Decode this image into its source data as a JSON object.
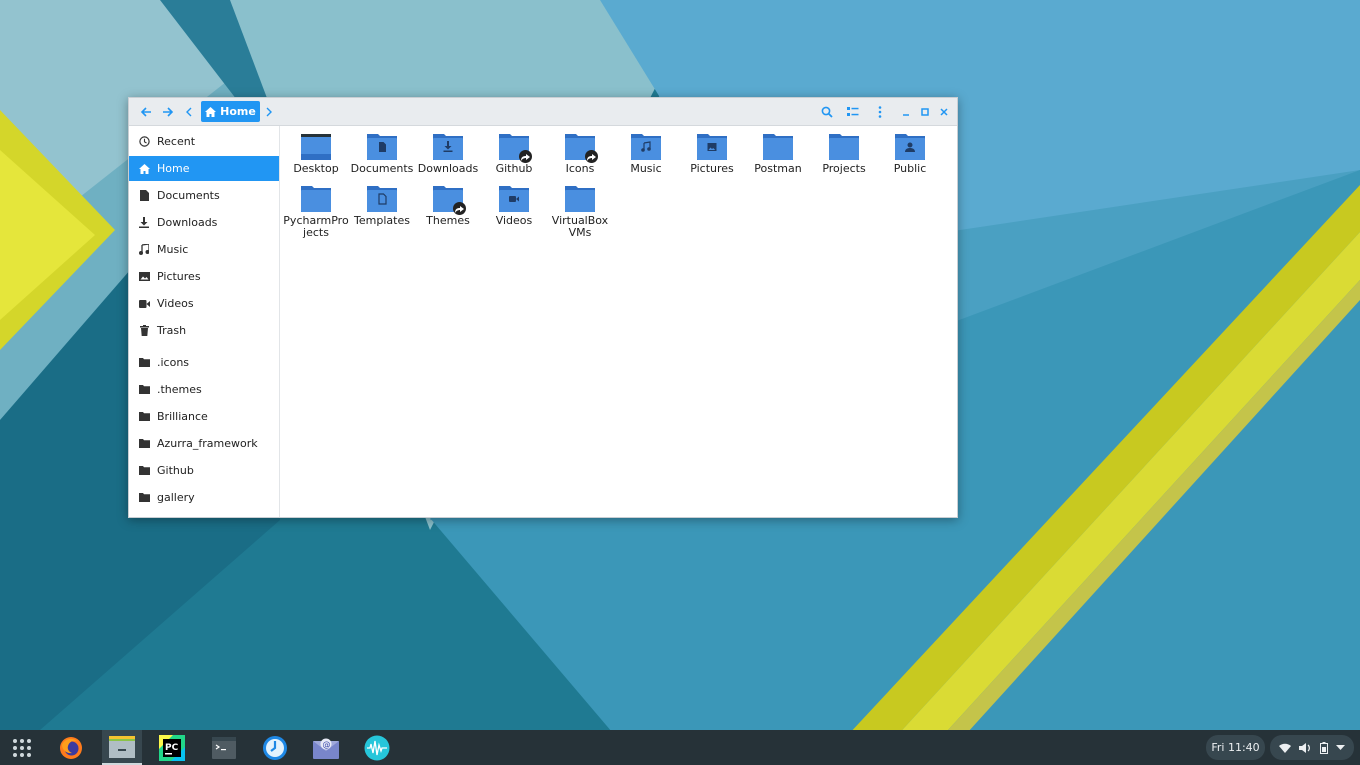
{
  "window": {
    "path": {
      "current_label": "Home"
    },
    "sidebar": {
      "places": [
        {
          "label": "Recent",
          "icon": "clock-icon"
        },
        {
          "label": "Home",
          "icon": "home-icon",
          "active": true
        },
        {
          "label": "Documents",
          "icon": "document-icon"
        },
        {
          "label": "Downloads",
          "icon": "download-icon"
        },
        {
          "label": "Music",
          "icon": "music-icon"
        },
        {
          "label": "Pictures",
          "icon": "picture-icon"
        },
        {
          "label": "Videos",
          "icon": "video-icon"
        },
        {
          "label": "Trash",
          "icon": "trash-icon"
        }
      ],
      "bookmarks": [
        {
          "label": ".icons",
          "icon": "folder-icon"
        },
        {
          "label": ".themes",
          "icon": "folder-icon"
        },
        {
          "label": "Brilliance",
          "icon": "folder-icon"
        },
        {
          "label": "Azurra_framework",
          "icon": "folder-icon"
        },
        {
          "label": "Github",
          "icon": "folder-icon"
        },
        {
          "label": "gallery",
          "icon": "folder-icon"
        }
      ]
    },
    "files": [
      {
        "name": "Desktop",
        "emblem": "desktop"
      },
      {
        "name": "Documents",
        "emblem": "document"
      },
      {
        "name": "Downloads",
        "emblem": "download"
      },
      {
        "name": "Github",
        "emblem": "none",
        "link": true
      },
      {
        "name": "Icons",
        "emblem": "none",
        "link": true
      },
      {
        "name": "Music",
        "emblem": "music"
      },
      {
        "name": "Pictures",
        "emblem": "picture"
      },
      {
        "name": "Postman",
        "emblem": "none"
      },
      {
        "name": "Projects",
        "emblem": "none"
      },
      {
        "name": "Public",
        "emblem": "public"
      },
      {
        "name": "PycharmProjects",
        "emblem": "none"
      },
      {
        "name": "Templates",
        "emblem": "template"
      },
      {
        "name": "Themes",
        "emblem": "none",
        "link": true
      },
      {
        "name": "Videos",
        "emblem": "video"
      },
      {
        "name": "VirtualBox VMs",
        "emblem": "none"
      }
    ]
  },
  "taskbar": {
    "apps": [
      {
        "name": "app-grid-launcher"
      },
      {
        "name": "firefox"
      },
      {
        "name": "files",
        "active": true
      },
      {
        "name": "pycharm",
        "label": "PC"
      },
      {
        "name": "terminal"
      },
      {
        "name": "timer-app"
      },
      {
        "name": "mail-app"
      },
      {
        "name": "audio-app"
      }
    ],
    "clock": "Fri 11:40",
    "tray": [
      "wifi-icon",
      "volume-icon",
      "battery-icon",
      "menu-arrow-icon"
    ]
  },
  "colors": {
    "accent": "#2196f3",
    "folder": "#4a8fe0",
    "folder_dark": "#2f6fc4",
    "taskbar": "#263238"
  }
}
